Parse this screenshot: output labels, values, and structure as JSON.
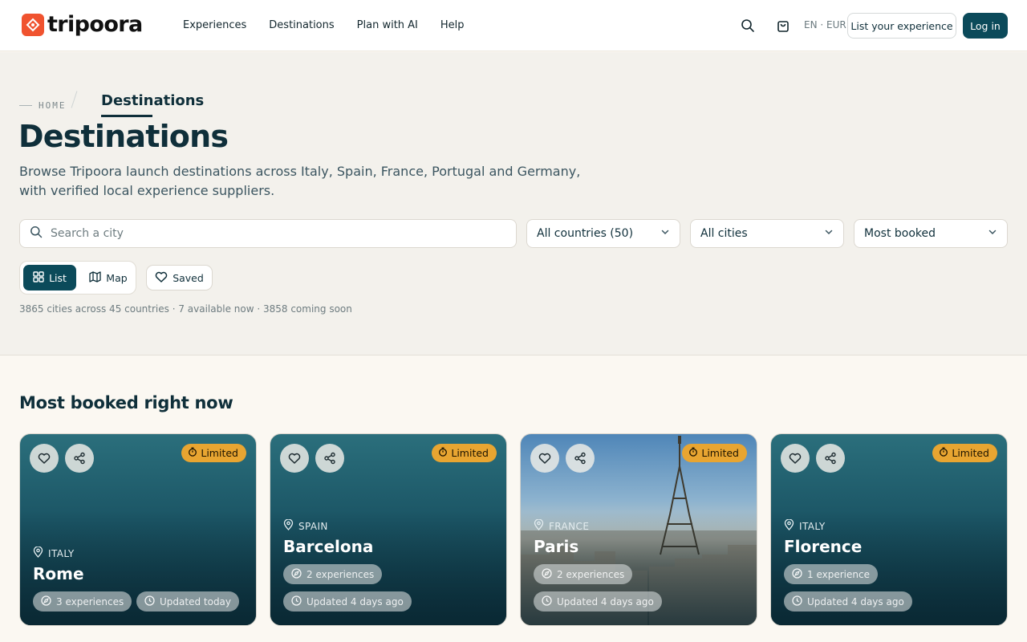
{
  "header": {
    "brand": "tripoora",
    "nav": [
      "Experiences",
      "Destinations",
      "Plan with AI",
      "Help"
    ],
    "locale": "EN · EUR",
    "list_experience": "List your experience",
    "login": "Log in"
  },
  "breadcrumb": {
    "home": "HOME",
    "current": "Destinations"
  },
  "hero": {
    "title": "Destinations",
    "description": "Browse Tripoora launch destinations across Italy, Spain, France, Portugal and Germany, with verified local experience suppliers."
  },
  "filters": {
    "search_placeholder": "Search a city",
    "search_value": "",
    "country": "All countries (50)",
    "city": "All cities",
    "sort": "Most booked"
  },
  "view": {
    "list": "List",
    "map": "Map",
    "saved": "Saved",
    "active": "List"
  },
  "stats": "3865 cities across 45 countries · 7 available now · 3858 coming soon",
  "section": {
    "title": "Most booked right now"
  },
  "cards": [
    {
      "country": "ITALY",
      "city": "Rome",
      "badge": "Limited",
      "experiences": "3 experiences",
      "updated": "Updated today",
      "pills_inline": true
    },
    {
      "country": "SPAIN",
      "city": "Barcelona",
      "badge": "Limited",
      "experiences": "2 experiences",
      "updated": "Updated 4 days ago",
      "pills_inline": false
    },
    {
      "country": "FRANCE",
      "city": "Paris",
      "badge": "Limited",
      "experiences": "2 experiences",
      "updated": "Updated 4 days ago",
      "pills_inline": false,
      "has_photo": true
    },
    {
      "country": "ITALY",
      "city": "Florence",
      "badge": "Limited",
      "experiences": "1 experience",
      "updated": "Updated 4 days ago",
      "pills_inline": false
    }
  ],
  "colors": {
    "primary": "#0b4a5a",
    "accent": "#f0532f",
    "badge": "#e8a531",
    "page_bg": "#fbf8f2",
    "hero_bg": "#f3f1ec"
  }
}
